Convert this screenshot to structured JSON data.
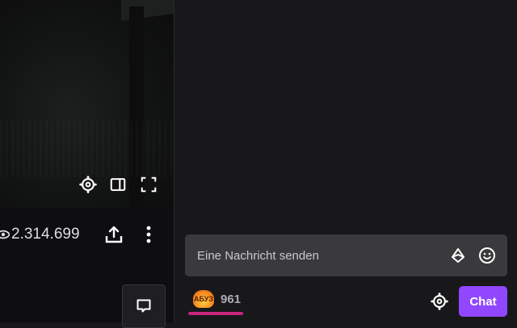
{
  "player": {
    "viewer_count": "2.314.699",
    "buttons": [
      "settings-icon",
      "theatre-mode-icon",
      "fullscreen-icon"
    ]
  },
  "stream_actions": {
    "share_icon": "share-icon",
    "more_icon": "more-vertical-icon",
    "chat_toggle_icon": "chat-bubble-icon"
  },
  "chat": {
    "input_placeholder": "Eine Nachricht senden",
    "bits_icon": "bits-icon",
    "emote_icon": "emote-smiley-icon",
    "channel_points_badge": "АБУЗ",
    "channel_points": "961",
    "settings_icon": "gear-icon",
    "send_label": "Chat"
  },
  "colors": {
    "accent": "#9147ff",
    "background": "#18181b",
    "input_bg": "#3a3a3d",
    "underline": "#c9257c"
  }
}
